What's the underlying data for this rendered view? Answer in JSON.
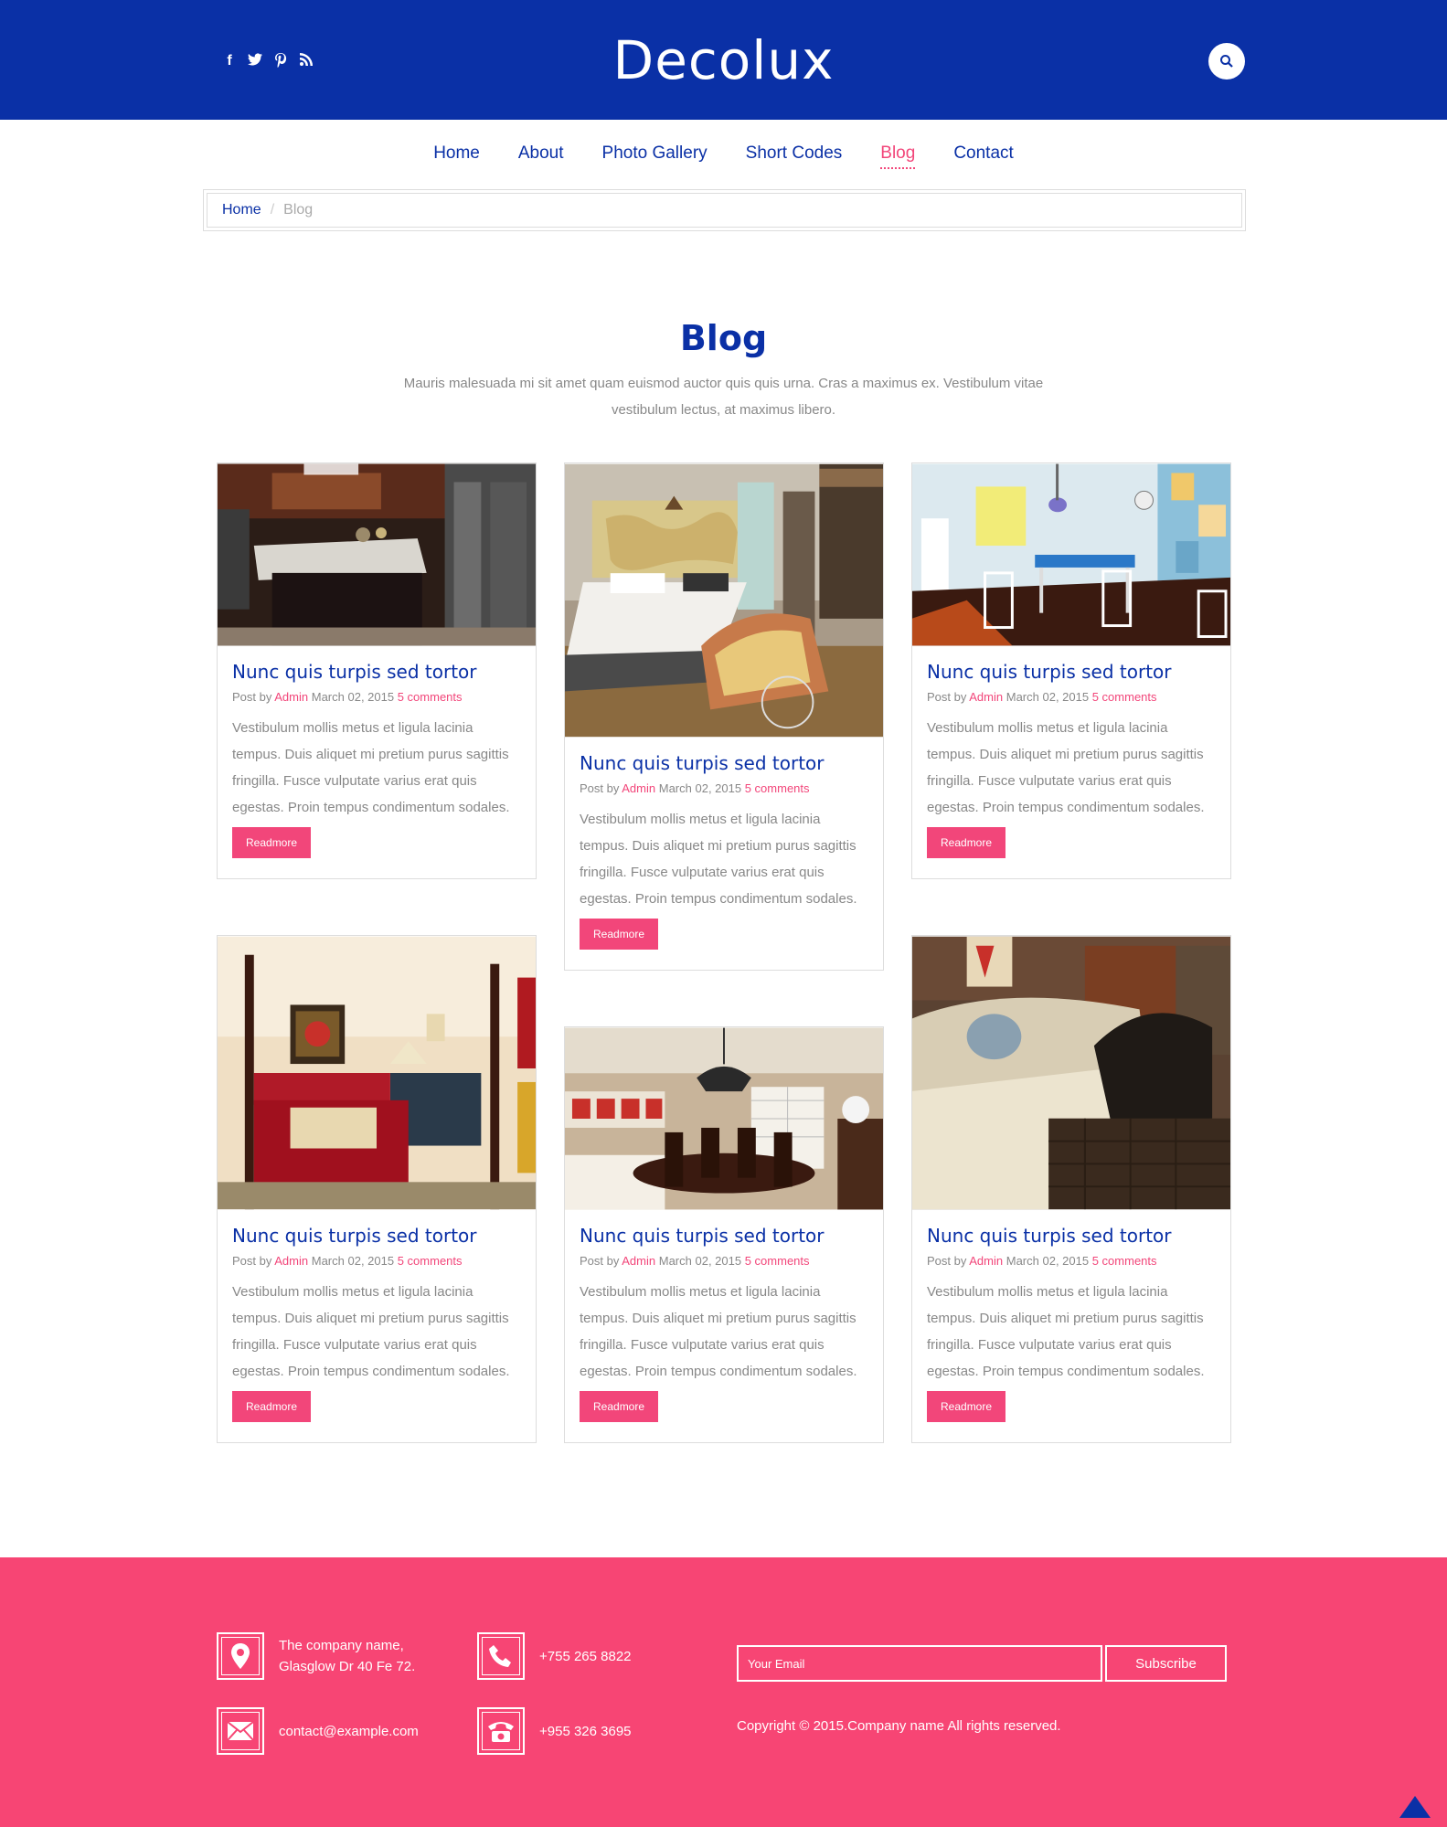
{
  "header": {
    "logo": "Decolux",
    "social": [
      "f",
      "t",
      "p",
      "rss"
    ]
  },
  "nav": {
    "items": [
      "Home",
      "About",
      "Photo Gallery",
      "Short Codes",
      "Blog",
      "Contact"
    ],
    "active": "Blog"
  },
  "breadcrumb": {
    "home": "Home",
    "separator": "/",
    "current": "Blog"
  },
  "section": {
    "title": "Blog",
    "subtitle": "Mauris malesuada mi sit amet quam euismod auctor quis quis urna. Cras a maximus ex. Vestibulum vitae vestibulum lectus, at maximus libero."
  },
  "post": {
    "title": "Nunc quis turpis sed tortor",
    "post_by": "Post by",
    "author": "Admin",
    "date": "March 02, 2015",
    "comments": "5 comments",
    "excerpt": "Vestibulum mollis metus et ligula lacinia tempus. Duis aliquet mi pretium purus sagittis fringilla. Fusce vulputate varius erat quis egestas. Proin tempus condimentum sodales.",
    "readmore": "Readmore"
  },
  "posts": [
    {
      "image": "kitchen-photo"
    },
    {
      "image": "bedroom-world-map-photo"
    },
    {
      "image": "blue-dining-room-photo"
    },
    {
      "image": "red-bedroom-photo"
    },
    {
      "image": "dining-room-chandelier-photo"
    },
    {
      "image": "cream-sofa-photo"
    }
  ],
  "footer": {
    "address": [
      "The company name,",
      "Glasglow Dr 40 Fe 72."
    ],
    "phone1": "+755 265 8822",
    "email": "contact@example.com",
    "phone2": "+955 326 3695",
    "email_placeholder": "Your Email",
    "subscribe": "Subscribe",
    "copyright": "Copyright © 2015.Company name All rights reserved."
  },
  "colors": {
    "primary": "#0a30a6",
    "accent": "#f2467a",
    "footer": "#f74574"
  }
}
